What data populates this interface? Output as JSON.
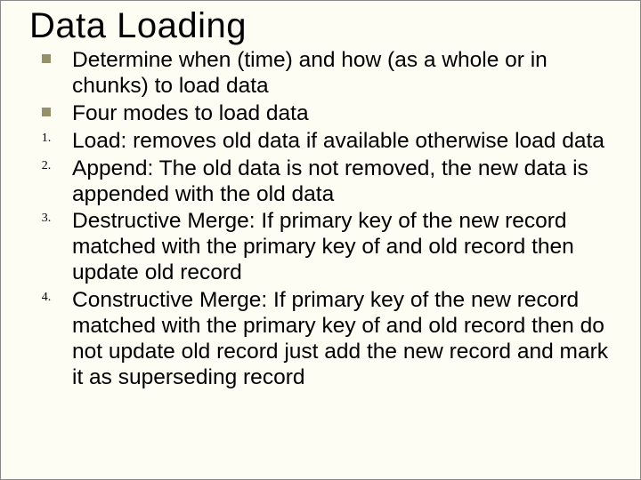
{
  "title": "Data Loading",
  "items": [
    {
      "marker_type": "square",
      "marker": "",
      "text": "Determine when (time) and how (as a whole or in chunks) to load data"
    },
    {
      "marker_type": "square",
      "marker": "",
      "text": "Four modes to load data"
    },
    {
      "marker_type": "number",
      "marker": "1.",
      "text": "Load: removes old data if available otherwise load data"
    },
    {
      "marker_type": "number",
      "marker": "2.",
      "text": "Append: The old data is not removed, the new data is appended with the old data"
    },
    {
      "marker_type": "number",
      "marker": "3.",
      "text": "Destructive Merge: If primary key of the new record matched with the primary key of and old record then update old record"
    },
    {
      "marker_type": "number",
      "marker": "4.",
      "text": "Constructive Merge: If primary key of the new record matched with the primary key of and old record then do not update old record just add the new record and mark it as superseding record"
    }
  ]
}
